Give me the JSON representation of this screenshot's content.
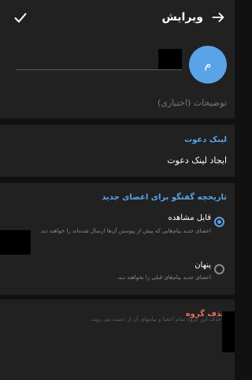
{
  "header": {
    "title": "ویرایش"
  },
  "group": {
    "avatar_letter": "م",
    "name_value": "",
    "description_placeholder": "توضیحات (اختیاری)"
  },
  "invite": {
    "header": "لینک دعوت",
    "create_label": "ایجاد لینک دعوت"
  },
  "history": {
    "header": "تاریخچه گفتگو برای اعضای جدید",
    "options": [
      {
        "title": "قابل مشاهده",
        "desc": "اعضای جدید پیام‌هایی که پیش از پیوستن آن‌ها ارسال شده‌اند را خواهند دید.",
        "selected": true
      },
      {
        "title": "پنهان",
        "desc": "اعضای جدید پیام‌های قبلی را نخواهند دید.",
        "selected": false
      }
    ]
  },
  "delete": {
    "title": "حذف گروه",
    "desc": "حذف این گروه تمام اعضا و پیامهای آن از دست می روند."
  },
  "colors": {
    "accent": "#5AA3E6",
    "danger": "#E36D62",
    "surface": "#212121",
    "background": "#111111"
  }
}
